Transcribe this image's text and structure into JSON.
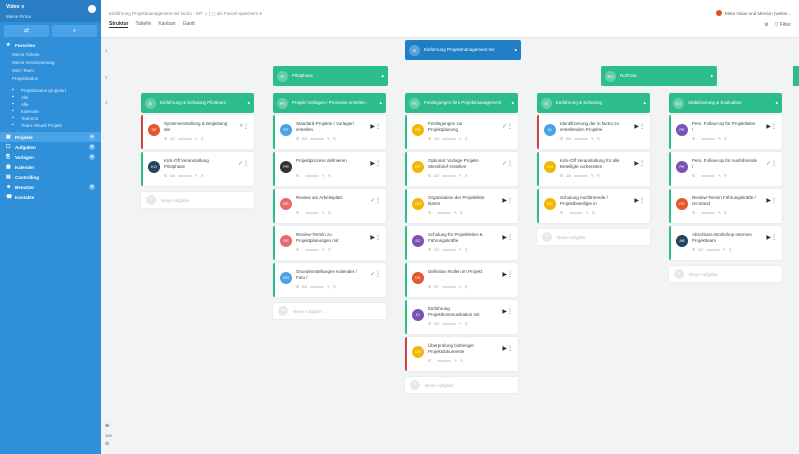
{
  "sidebar": {
    "workspace": "Video ∨",
    "subtitle": "Meine Firma",
    "tools": [
      "⇄",
      "⌕"
    ],
    "favorites_label": "Favoriten",
    "fav_items": [
      "Meine Tickets",
      "Meine Verantwortung",
      "Mein Team",
      "Projektstatus"
    ],
    "tree_items": [
      "Projektstatus gruppiert",
      "Alle",
      "Alle",
      "Kalender",
      "Teammit",
      "Team Aktuell Projekt"
    ],
    "nav": [
      {
        "label": "Projekte",
        "icon": "▣",
        "active": true,
        "plus": true
      },
      {
        "label": "Aufgaben",
        "icon": "☐",
        "plus": true
      },
      {
        "label": "Vorlagen",
        "icon": "⎘",
        "plus": true
      },
      {
        "label": "Kalender",
        "icon": "▦",
        "plus": false
      },
      {
        "label": "Controlling",
        "icon": "▤",
        "plus": false
      },
      {
        "label": "Benutzer",
        "icon": "☻",
        "plus": true
      },
      {
        "label": "Kontakte",
        "icon": "☎",
        "plus": false
      }
    ]
  },
  "topbar": {
    "breadcrumb": "Einführung Projektmanagement mit factro - MT ☆ | ▢ als Favorit speichern  ▾",
    "views": [
      "Struktur",
      "Tabelle",
      "Kanban",
      "Gantt"
    ],
    "user": "Meta Value und Mission (weiter...",
    "filter_label": "Filter"
  },
  "board": {
    "row_numbers": [
      "1",
      "2",
      "3"
    ],
    "root": {
      "badge": "EI",
      "label": "Einführung Projektmanagement mit"
    },
    "level2": [
      {
        "badge": "PI",
        "label": "Pilotphase"
      },
      {
        "badge": "RO",
        "label": "Roll-Out"
      }
    ],
    "columns": [
      {
        "badge": "EI",
        "label": "Einführung & Schulung Pilotteam"
      },
      {
        "badge": "PR",
        "label": "Projekt Vorlagen / Prozesse erstellen"
      },
      {
        "badge": "FE",
        "label": "Festlegungen fürs Projektmanagement"
      },
      {
        "badge": "EI",
        "label": "Einführung & Schulung"
      },
      {
        "badge": "EV",
        "label": "Stabilisierung & Evaluation"
      }
    ],
    "cards": [
      [
        {
          "av": "SE",
          "color": "#e2572b",
          "title": "Systemeinstellung & Begleitung der",
          "meta": "4/7",
          "status": "○",
          "red": true
        },
        {
          "av": "KO",
          "color": "#23435e",
          "title": "Kick-Off Veranstaltung Pilotphase",
          "meta": "0/4",
          "status": "✓",
          "red": false
        }
      ],
      [
        {
          "av": "ST",
          "color": "#4aa3e6",
          "title": "Standard-Projekte / Vorlagen erstellen",
          "meta": "0/3",
          "status": "▶",
          "red": false
        },
        {
          "av": "PR",
          "color": "#333333",
          "title": "Projektprozess definieren",
          "meta": "",
          "status": "▶",
          "red": false
        },
        {
          "av": "RE",
          "color": "#e86a6a",
          "title": "Review am Arbeitsplatz",
          "meta": "",
          "status": "✓",
          "red": false
        },
        {
          "av": "RE",
          "color": "#e86a6a",
          "title": "Review-Termin zu Projektplanungen mit",
          "meta": "",
          "status": "▶",
          "red": false
        },
        {
          "av": "GR",
          "color": "#4aa3e6",
          "title": "Grundeinstellungen Kalender / Foto /",
          "meta": "0/6",
          "status": "✓",
          "red": false
        }
      ],
      [
        {
          "av": "FE",
          "color": "#f2b705",
          "title": "Festlegungen zur Projektplanung",
          "meta": "0/3",
          "status": "✓",
          "red": false
        },
        {
          "av": "OP",
          "color": "#f2b705",
          "title": "Optional: Vorlage Projekt-Steckbrief erstellen",
          "meta": "0/2",
          "status": "✓",
          "red": false
        },
        {
          "av": "OR",
          "color": "#f2b705",
          "title": "Organisation der Projektliste klären",
          "meta": "",
          "status": "▶",
          "red": false
        },
        {
          "av": "SC",
          "color": "#7a52b5",
          "title": "Schulung für Projektleiter & Führungskräfte",
          "meta": "0/3",
          "status": "▶",
          "red": false
        },
        {
          "av": "DE",
          "color": "#e2572b",
          "title": "Definition Rollen im Projekt",
          "meta": "0/7",
          "status": "▶",
          "red": false
        },
        {
          "av": "EI",
          "color": "#7a52b5",
          "title": "Einführung Projektkommunikation mit",
          "meta": "0/4",
          "status": "▶",
          "red": false
        },
        {
          "av": "ÜB",
          "color": "#f2b705",
          "title": "Überprüfung bisheriger Projektdokumente",
          "meta": "",
          "status": "▶",
          "red": true
        }
      ],
      [
        {
          "av": "ID",
          "color": "#4aa3e6",
          "title": "Identifizierung der in factro zu erstellenden Projekte",
          "meta": "0/5",
          "status": "▶",
          "red": true
        },
        {
          "av": "KO",
          "color": "#f2b705",
          "title": "Kick-Off Veranstaltung für alle Beteiligte vorbereiten",
          "meta": "1/6",
          "status": "▶",
          "red": false
        },
        {
          "av": "SC",
          "color": "#f2b705",
          "title": "Schulung Ausführende / Projektbeteiligte in",
          "meta": "",
          "status": "▶",
          "red": false
        }
      ],
      [
        {
          "av": "PE",
          "color": "#7a52b5",
          "title": "Pers. Follow-Up für Projektleiter /",
          "meta": "",
          "status": "▶",
          "red": false
        },
        {
          "av": "PE",
          "color": "#7a52b5",
          "title": "Pers. Follow-Up für Ausführende /",
          "meta": "",
          "status": "✓",
          "red": false
        },
        {
          "av": "RE",
          "color": "#e2572b",
          "title": "Review-Termin Führungskräfte / Ist-Stand",
          "meta": "",
          "status": "▶",
          "red": false
        },
        {
          "av": "AB",
          "color": "#23435e",
          "title": "Abschluss-Workshop Internes Projektteam",
          "meta": "0/4",
          "status": "▶",
          "red": false
        }
      ]
    ],
    "new_task_label": "Neue Aufgabe",
    "zoom_level": "100"
  }
}
